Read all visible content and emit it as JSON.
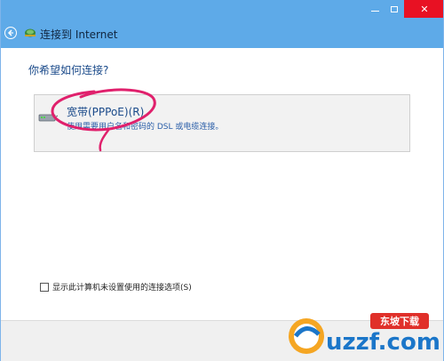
{
  "window": {
    "header_title": "连接到 Internet",
    "controls": {
      "minimize_icon": "minimize-icon",
      "maximize_icon": "maximize-icon",
      "close_icon": "close-icon"
    }
  },
  "main": {
    "question": "你希望如何连接?",
    "options": [
      {
        "icon": "broadband-modem-icon",
        "title": "宽带(PPPoE)(R)",
        "description": "使用需要用户名和密码的 DSL 或电缆连接。"
      }
    ],
    "checkbox": {
      "label": "显示此计算机未设置使用的连接选项(S)",
      "checked": false
    }
  },
  "watermark": {
    "logo_text": "uzzf.com",
    "badge_text": "东坡下载"
  },
  "colors": {
    "title_bar": "#5eaae8",
    "close_button": "#e81123",
    "link_text": "#1a4a8a",
    "annotation": "#e0206c"
  }
}
